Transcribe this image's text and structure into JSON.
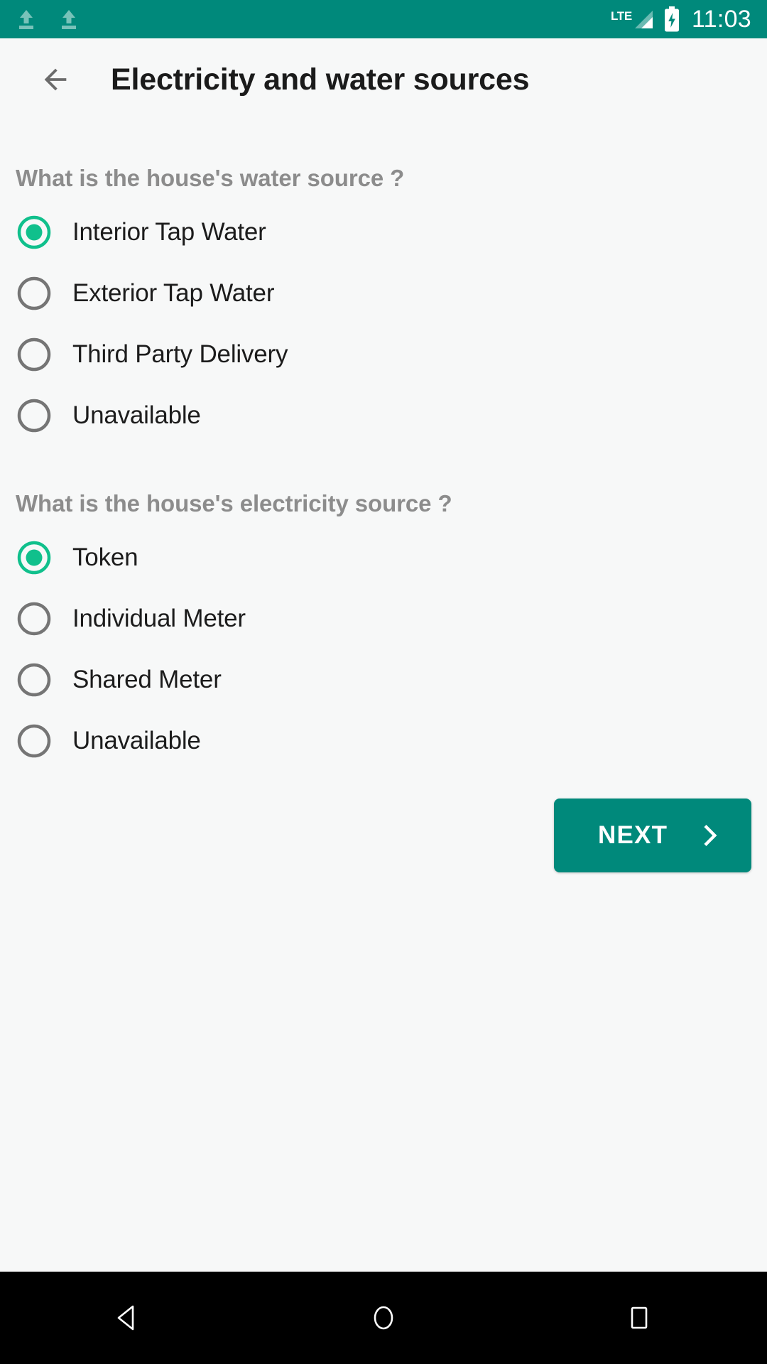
{
  "statusbar": {
    "icons": [
      "upload-arrow-icon",
      "upload-arrow-icon"
    ],
    "network_label": "LTE",
    "signal_icon": "signal-bars-icon",
    "battery_icon": "battery-charging-icon",
    "time": "11:03",
    "background_color": "#00897B"
  },
  "appbar": {
    "back_icon": "arrow-left-icon",
    "title": "Electricity and water sources"
  },
  "form": {
    "groups": [
      {
        "id": "water",
        "question": "What is the house's water source ?",
        "options": [
          {
            "label": "Interior Tap Water",
            "selected": true
          },
          {
            "label": "Exterior Tap Water",
            "selected": false
          },
          {
            "label": "Third Party Delivery",
            "selected": false
          },
          {
            "label": "Unavailable",
            "selected": false
          }
        ]
      },
      {
        "id": "electricity",
        "question": "What is the house's electricity source ?",
        "options": [
          {
            "label": "Token",
            "selected": true
          },
          {
            "label": "Individual Meter",
            "selected": false
          },
          {
            "label": "Shared Meter",
            "selected": false
          },
          {
            "label": "Unavailable",
            "selected": false
          }
        ]
      }
    ]
  },
  "next_button": {
    "label": "NEXT",
    "icon": "chevron-right-icon",
    "background_color": "#00897B"
  },
  "navbar": {
    "back_icon": "triangle-back-icon",
    "home_icon": "circle-home-icon",
    "recents_icon": "square-recents-icon"
  },
  "colors": {
    "status_bar": "#00897B",
    "accent_selected": "#10C08C",
    "radio_unselected": "#757575",
    "question_text": "#8c8c8c",
    "page_background": "#f7f8f8",
    "navbar": "#000000"
  }
}
